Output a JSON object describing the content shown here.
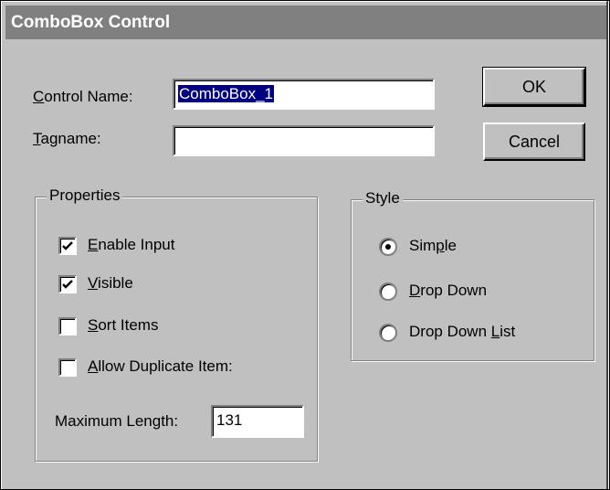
{
  "dialog": {
    "title": "ComboBox Control",
    "control_name_label": "Control Name:",
    "control_name_value": "ComboBox_1",
    "tagname_label": "Tagname:",
    "tagname_value": "",
    "ok_label": "OK",
    "cancel_label": "Cancel"
  },
  "properties": {
    "legend": "Properties",
    "items": [
      {
        "label": "Enable Input",
        "checked": true
      },
      {
        "label": "Visible",
        "checked": true
      },
      {
        "label": "Sort Items",
        "checked": false
      },
      {
        "label": "Allow Duplicate Item:",
        "checked": false
      }
    ],
    "max_length_label": "Maximum Length:",
    "max_length_value": "131"
  },
  "style": {
    "legend": "Style",
    "options": [
      {
        "label": "Simple",
        "selected": true
      },
      {
        "label": "Drop Down",
        "selected": false
      },
      {
        "label": "Drop Down List",
        "selected": false
      }
    ]
  },
  "colors": {
    "face": "#c0c0c0",
    "titlebar": "#808080",
    "selection": "#000080"
  }
}
